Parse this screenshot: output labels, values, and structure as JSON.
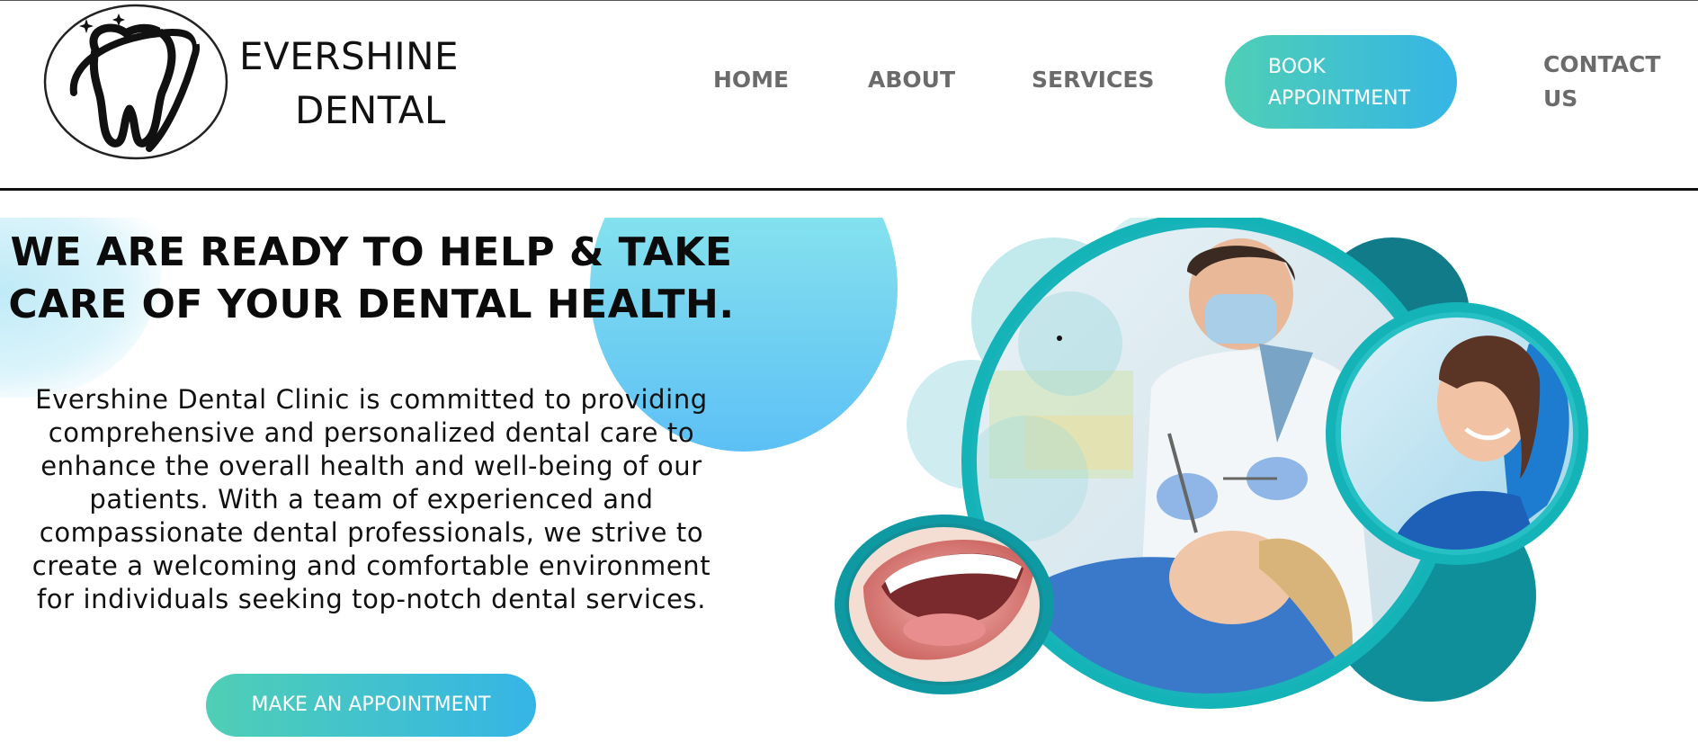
{
  "brand": {
    "name_line1": "EVERSHINE",
    "name_line2": "DENTAL",
    "logo_icon": "tooth-with-sparkles-icon"
  },
  "nav": {
    "items": [
      {
        "label": "HOME"
      },
      {
        "label": "ABOUT"
      },
      {
        "label": "SERVICES"
      }
    ],
    "book_button": {
      "line1": "BOOK",
      "line2": "APPOINTMENT"
    },
    "contact": {
      "line1": "CONTACT",
      "line2": "US"
    }
  },
  "hero": {
    "headline_line1": "WE ARE READY TO HELP & TAKE",
    "headline_line2": "CARE OF YOUR DENTAL HEALTH.",
    "paragraph_lines": [
      "Evershine Dental Clinic is committed to providing",
      "comprehensive and personalized dental care to",
      "enhance the overall health and well-being of our",
      "patients. With a team of experienced and",
      "compassionate dental professionals, we strive to",
      "create a welcoming and comfortable environment",
      "for individuals seeking top-notch dental services."
    ],
    "cta_label": "MAKE AN APPOINTMENT",
    "images": [
      {
        "subject": "dentist-treating-patient-photo"
      },
      {
        "subject": "smiling-teeth-closeup-photo"
      },
      {
        "subject": "smiling-woman-in-dental-chair-photo"
      }
    ]
  },
  "colors": {
    "accent_start": "#4fcfb5",
    "accent_end": "#35b5e5",
    "nav_text": "#6b6b6b",
    "frame_teal": "#14b3b8",
    "text_dark": "#111111"
  }
}
